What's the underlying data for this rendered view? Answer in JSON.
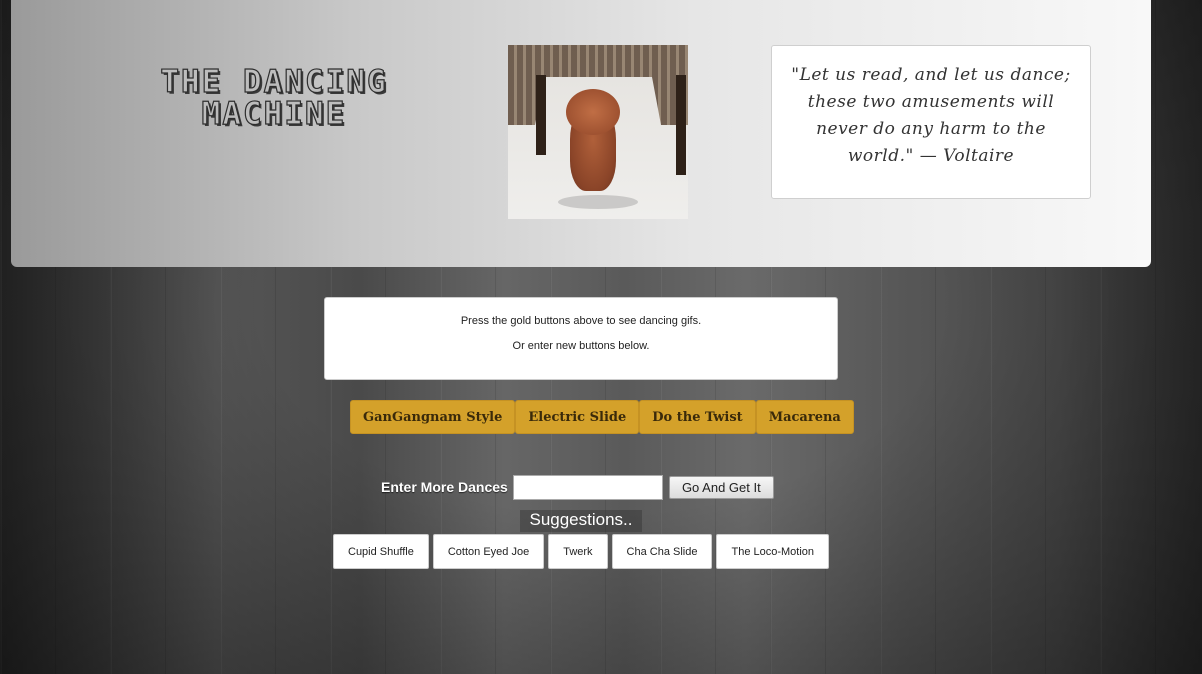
{
  "header": {
    "title_line1": "The Dancing",
    "title_line2": "Machine",
    "quote_text": "\"Let us read, and let us dance; these two amusements will never do any harm to the world.\" — Voltaire"
  },
  "info": {
    "line1": "Press the gold buttons above to see dancing gifs.",
    "line2": "Or enter new buttons below."
  },
  "dance_buttons": [
    "GanGangnam Style",
    "Electric Slide",
    "Do the Twist",
    "Macarena"
  ],
  "form": {
    "label": "Enter More Dances",
    "input_value": "",
    "submit_label": "Go And Get It"
  },
  "suggestions": {
    "title": "Suggestions..",
    "items": [
      "Cupid Shuffle",
      "Cotton Eyed Joe",
      "Twerk",
      "Cha Cha Slide",
      "The Loco-Motion"
    ]
  },
  "colors": {
    "gold_button": "#d4a12a"
  }
}
